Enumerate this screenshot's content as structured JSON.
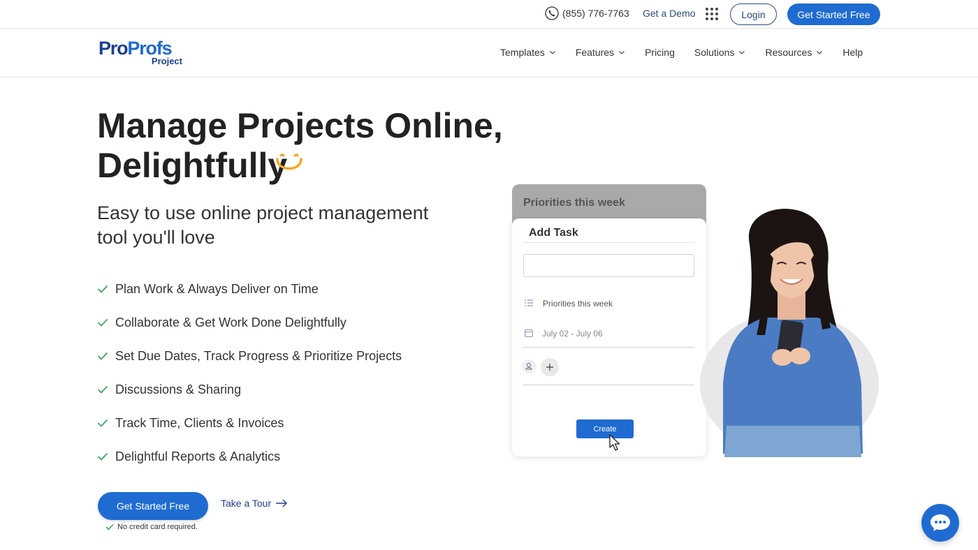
{
  "topbar": {
    "phone": "(855) 776-7763",
    "demo_label": "Get a Demo",
    "login_label": "Login",
    "cta_label": "Get Started Free"
  },
  "nav": {
    "logo_text": "ProProfs",
    "logo_sub": "Project",
    "items": [
      {
        "label": "Templates",
        "dropdown": true
      },
      {
        "label": "Features",
        "dropdown": true
      },
      {
        "label": "Pricing",
        "dropdown": false
      },
      {
        "label": "Solutions",
        "dropdown": true
      },
      {
        "label": "Resources",
        "dropdown": true
      },
      {
        "label": "Help",
        "dropdown": false
      }
    ]
  },
  "hero": {
    "headline_line1": "Manage Projects Online,",
    "headline_line2": "Delightfully",
    "subtitle_line1": "Easy to use online project management",
    "subtitle_line2": "tool you'll love",
    "features": [
      "Plan Work & Always Deliver on Time",
      "Collaborate & Get Work Done Delightfully",
      "Set Due Dates, Track Progress & Prioritize Projects",
      "Discussions & Sharing",
      "Track Time, Clients & Invoices",
      "Delightful Reports & Analytics"
    ],
    "cta_label": "Get Started Free",
    "tour_label": "Take a Tour",
    "no_card_note": "No credit card required."
  },
  "task_card": {
    "back_title": "Priorities this week",
    "title": "Add Task",
    "list_label": "Priorities this week",
    "date_label": "July 02 - July 06",
    "create_label": "Create"
  },
  "colors": {
    "primary": "#1f6bd1",
    "logo_dark": "#1d3f91",
    "check_green": "#3aa65f",
    "smile_yellow": "#f5a623"
  },
  "icons": {
    "phone": "phone-icon",
    "apps": "apps-grid-icon",
    "chevron": "chevron-down-icon",
    "check": "check-icon",
    "arrow": "arrow-right-icon",
    "chat": "chat-bubble-icon"
  }
}
